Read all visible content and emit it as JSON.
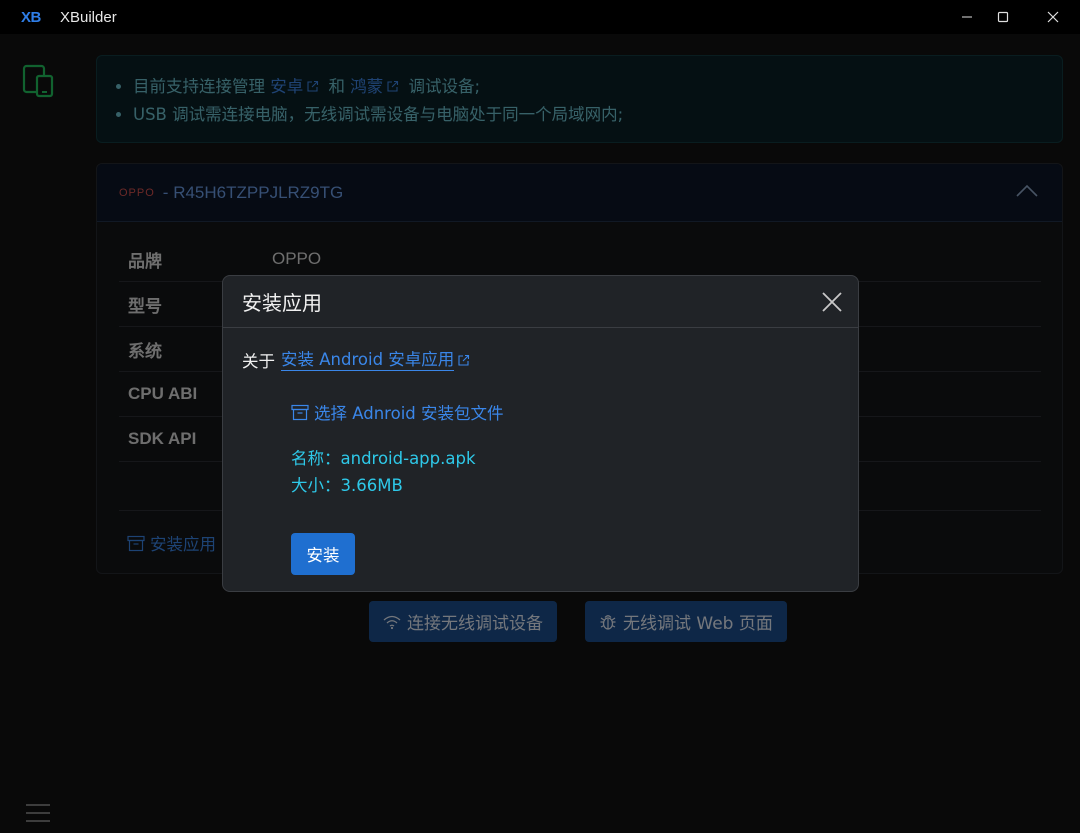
{
  "window": {
    "logo": "XB",
    "title": "XBuilder"
  },
  "sidebar": {
    "device_icon": "devices-icon",
    "menu_icon": "hamburger-menu-icon"
  },
  "notice": {
    "line1_prefix": "目前支持连接管理",
    "link_android": "安卓",
    "line1_and": "和",
    "link_harmony": "鸿蒙",
    "line1_suffix": "调试设备;",
    "line2": "USB 调试需连接电脑，无线调试需设备与电脑处于同一个局域网内;"
  },
  "device_card": {
    "brand_badge": "OPPO",
    "separator": "-",
    "serial": "R45H6TZPPJLRZ9TG",
    "rows": [
      {
        "label": "品牌",
        "value": "OPPO"
      },
      {
        "label": "型号",
        "value": ""
      },
      {
        "label": "系统",
        "value": ""
      },
      {
        "label": "CPU ABI",
        "value": ""
      },
      {
        "label": "SDK API",
        "value": ""
      }
    ],
    "install_app_link": "安装应用"
  },
  "actions": {
    "connect_wireless": "连接无线调试设备",
    "wireless_web": "无线调试 Web 页面"
  },
  "modal": {
    "title": "安装应用",
    "about_prefix": "关于",
    "about_link": "安装 Android 安卓应用",
    "choose_file": "选择 Adnroid 安装包文件",
    "name_label": "名称：",
    "name_value": "android-app.apk",
    "size_label": "大小：",
    "size_value": "3.66MB",
    "install_button": "安装"
  },
  "colors": {
    "accent_blue": "#3a86e8",
    "device_icon_green": "#22c55e",
    "file_info_cyan": "#2ec8e8",
    "brand_red": "#d9534f"
  }
}
